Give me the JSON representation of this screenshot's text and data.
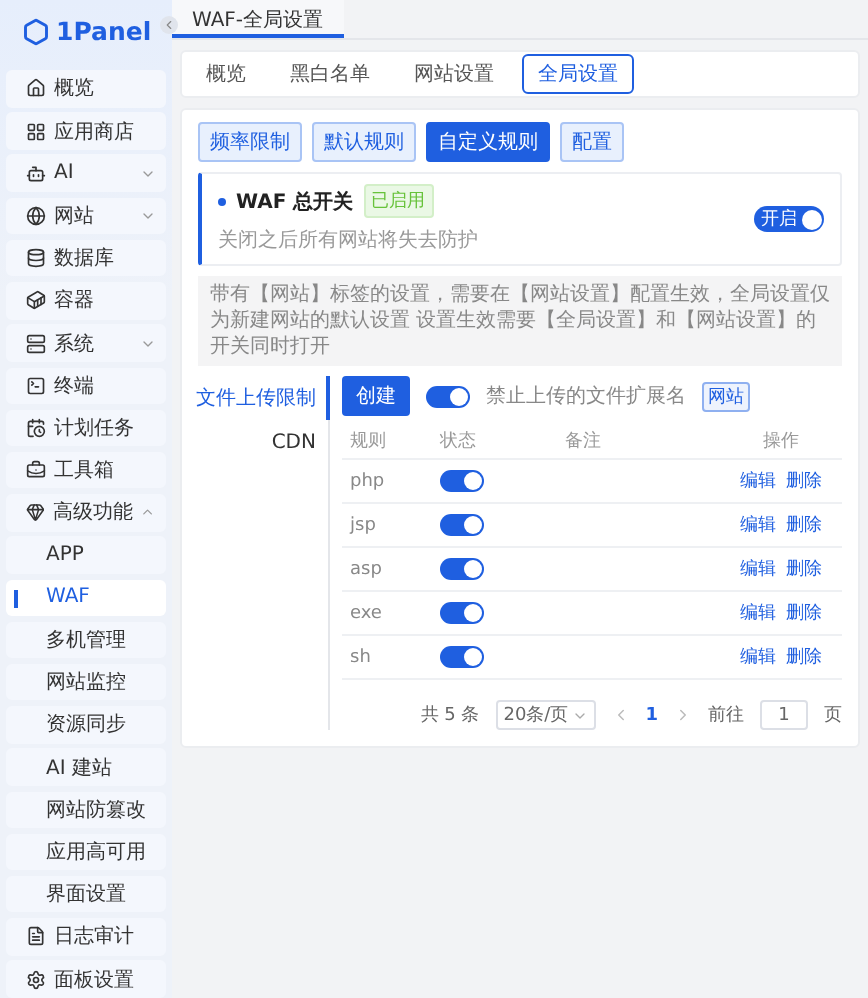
{
  "logo": {
    "text": "1Panel"
  },
  "sidebar": {
    "items": [
      {
        "label": "概览",
        "selected": false
      },
      {
        "label": "应用商店",
        "selected": false
      },
      {
        "label": "AI",
        "selected": false,
        "expanded": false
      },
      {
        "label": "网站",
        "selected": false,
        "expanded": false
      },
      {
        "label": "数据库",
        "selected": false
      },
      {
        "label": "容器",
        "selected": false
      },
      {
        "label": "系统",
        "selected": false,
        "expanded": false
      },
      {
        "label": "终端",
        "selected": false
      },
      {
        "label": "计划任务",
        "selected": false
      },
      {
        "label": "工具箱",
        "selected": false
      },
      {
        "label": "高级功能",
        "selected": false,
        "expanded": true,
        "children": [
          {
            "label": "APP",
            "selected": false
          },
          {
            "label": "WAF",
            "selected": true
          },
          {
            "label": "多机管理",
            "selected": false
          },
          {
            "label": "网站监控",
            "selected": false
          },
          {
            "label": "资源同步",
            "selected": false
          },
          {
            "label": "AI 建站",
            "selected": false
          },
          {
            "label": "网站防篡改",
            "selected": false
          },
          {
            "label": "应用高可用",
            "selected": false
          },
          {
            "label": "界面设置",
            "selected": false
          }
        ]
      },
      {
        "label": "日志审计",
        "selected": false
      },
      {
        "label": "面板设置",
        "selected": false
      }
    ]
  },
  "page_tab": {
    "label": "WAF-全局设置"
  },
  "section_tabs": [
    {
      "label": "概览",
      "selected": false
    },
    {
      "label": "黑白名单",
      "selected": false
    },
    {
      "label": "网站设置",
      "selected": false
    },
    {
      "label": "全局设置",
      "selected": true
    }
  ],
  "rule_tabs": [
    {
      "label": "频率限制",
      "selected": false
    },
    {
      "label": "默认规则",
      "selected": false
    },
    {
      "label": "自定义规则",
      "selected": true
    },
    {
      "label": "配置",
      "selected": false
    }
  ],
  "waf_switch": {
    "title": "WAF 总开关",
    "badge": "已启用",
    "description": "关闭之后所有网站将失去防护",
    "toggle_label": "开启",
    "on": true
  },
  "notice": "带有【网站】标签的设置，需要在【网站设置】配置生效，全局设置仅为新建网站的默认设置 设置生效需要【全局设置】和【网站设置】的开关同时打开",
  "submenu": [
    {
      "label": "文件上传限制",
      "selected": true
    },
    {
      "label": "CDN",
      "selected": false
    }
  ],
  "toolbar": {
    "create": "创建",
    "on": true,
    "label": "禁止上传的文件扩展名",
    "tag": "网站"
  },
  "table": {
    "columns": [
      "规则",
      "状态",
      "备注",
      "操作"
    ],
    "rows": [
      {
        "rule": "php",
        "on": true,
        "actions": [
          "编辑",
          "删除"
        ]
      },
      {
        "rule": "jsp",
        "on": true,
        "actions": [
          "编辑",
          "删除"
        ]
      },
      {
        "rule": "asp",
        "on": true,
        "actions": [
          "编辑",
          "删除"
        ]
      },
      {
        "rule": "exe",
        "on": true,
        "actions": [
          "编辑",
          "删除"
        ]
      },
      {
        "rule": "sh",
        "on": true,
        "actions": [
          "编辑",
          "删除"
        ]
      }
    ]
  },
  "pagination": {
    "total": "共 5 条",
    "page_size": "20条/页",
    "pages": [
      {
        "label": "1",
        "selected": true
      }
    ],
    "goto_label": "前往",
    "goto_value": "1",
    "goto_suffix": "页"
  }
}
